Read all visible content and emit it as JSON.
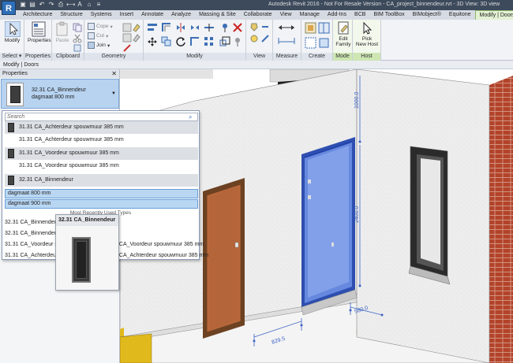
{
  "titlebar": {
    "app_letter": "R",
    "title": "Autodesk Revit 2016 -   Not For Resale Version -    CA_project_binnendeur.rvt - 3D View: 3D view"
  },
  "tabs": [
    "Architecture",
    "Structure",
    "Systems",
    "Insert",
    "Annotate",
    "Analyze",
    "Massing & Site",
    "Collaborate",
    "View",
    "Manage",
    "Add-Ins",
    "BCB",
    "BIM ToolBox",
    "BIMobject®",
    "Equitone",
    "Modify | Doors"
  ],
  "active_tab": "Modify | Doors",
  "ribbon": {
    "modify_label": "Modify",
    "properties_label": "Properties",
    "select_label": "Select ▾",
    "properties_panel_label": "Properties",
    "clipboard_label": "Clipboard",
    "paste_label": "Paste",
    "cope_label": "Cope",
    "cut_label": "Cut",
    "join_label": "Join",
    "geometry_label": "Geometry",
    "modify_panel_label": "Modify",
    "view_label": "View",
    "measure_label": "Measure",
    "create_label": "Create",
    "edit_family_label1": "Edit",
    "edit_family_label2": "Family",
    "mode_label": "Mode",
    "pick_host_label1": "Pick",
    "pick_host_label2": "New Host",
    "host_label": "Host"
  },
  "context_bar": "Modify | Doors",
  "properties": {
    "header": "Properties",
    "close": "✕",
    "type_line1": "32.31 CA_Binnendeur",
    "type_line2": "dagmaat 800 mm"
  },
  "dropdown": {
    "search_placeholder": "Search",
    "items": [
      {
        "label": "31.31 CA_Achterdeur spouwmuur 385 mm",
        "kind": "header"
      },
      {
        "label": "31.31 CA_Achterdeur spouwmuur 385 mm",
        "kind": "item"
      },
      {
        "label": "31.31 CA_Voordeur spouwmuur 385 mm",
        "kind": "header"
      },
      {
        "label": "31.31 CA_Voordeur spouwmuur 385 mm",
        "kind": "item"
      },
      {
        "label": "32.31 CA_Binnendeur",
        "kind": "header"
      },
      {
        "label": "dagmaat 800 mm",
        "kind": "selected"
      },
      {
        "label": "dagmaat 900 mm",
        "kind": "selected"
      }
    ],
    "mru_title": "Most Recently Used Types",
    "mru_items": [
      "32.31 CA_Binnendeur : dagmaat 800 mm",
      "32.31 CA_Binnendeur : dagmaat 900 mm",
      "31.31 CA_Voordeur spouwmuur 385 mm : 31.31 CA_Voordeur spouwmuur 385 mm",
      "31.31 CA_Achterdeur spouwmuur 385 mm : 31.31 CA_Achterdeur spouwmuur 385 mm"
    ],
    "mru_visible": {
      "a": "32.31 CA_Binnendeur : d",
      "b": "32.31 CA_Binnendeur : d",
      "c": "31.31 CA_Voordeur spo",
      "c2": "_CA_Voordeur spouwmuur 385 mm",
      "d": "31.31 CA_Achterdeur sp",
      "d2": "_CA_Achterdeur spouwmuur 385 mm"
    }
  },
  "tooltip": {
    "title": "32.31 CA_Binnendeur"
  },
  "dimensions": {
    "top": "1000.0",
    "height": "2400.0",
    "width_left": "829.5",
    "width_right": "580.0"
  },
  "colors": {
    "selection_blue": "#3f6fd8",
    "brick": "#b5452c",
    "door_wood": "#b8683a",
    "floor_yellow": "#e0b91c"
  }
}
